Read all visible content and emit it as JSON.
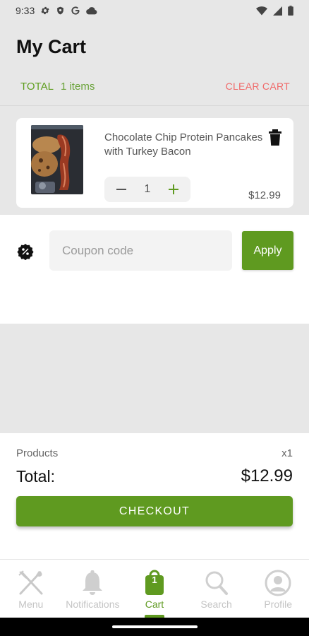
{
  "status_bar": {
    "time": "9:33",
    "left_icons": [
      "gear-icon",
      "shield-icon",
      "google-icon",
      "cloud-icon"
    ],
    "right_icons": [
      "wifi-icon",
      "signal-icon",
      "battery-icon"
    ]
  },
  "header": {
    "title": "My Cart",
    "total_label": "TOTAL",
    "item_count": "1 items",
    "clear_cart_label": "CLEAR CART"
  },
  "cart": {
    "items": [
      {
        "name": "Chocolate Chip Protein Pancakes with Turkey Bacon",
        "quantity": "1",
        "price": "$12.99",
        "image": "pancakes-and-bacon-photo"
      }
    ]
  },
  "coupon": {
    "icon": "percent-badge-icon",
    "placeholder": "Coupon code",
    "value": "",
    "apply_label": "Apply"
  },
  "summary": {
    "products_label": "Products",
    "products_count": "x1",
    "total_label": "Total:",
    "total_value": "$12.99",
    "checkout_label": "CHECKOUT"
  },
  "bottom_nav": {
    "items": [
      {
        "label": "Menu",
        "icon": "utensils-icon"
      },
      {
        "label": "Notifications",
        "icon": "bell-icon"
      },
      {
        "label": "Cart",
        "icon": "shopping-bag-icon",
        "badge": "1",
        "active": true
      },
      {
        "label": "Search",
        "icon": "search-icon"
      },
      {
        "label": "Profile",
        "icon": "profile-icon"
      }
    ]
  },
  "colors": {
    "accent": "#5f9a20",
    "clear_cart": "#f06a6a",
    "background": "#e7e7e7",
    "nav_inactive": "#c4c4c4"
  }
}
